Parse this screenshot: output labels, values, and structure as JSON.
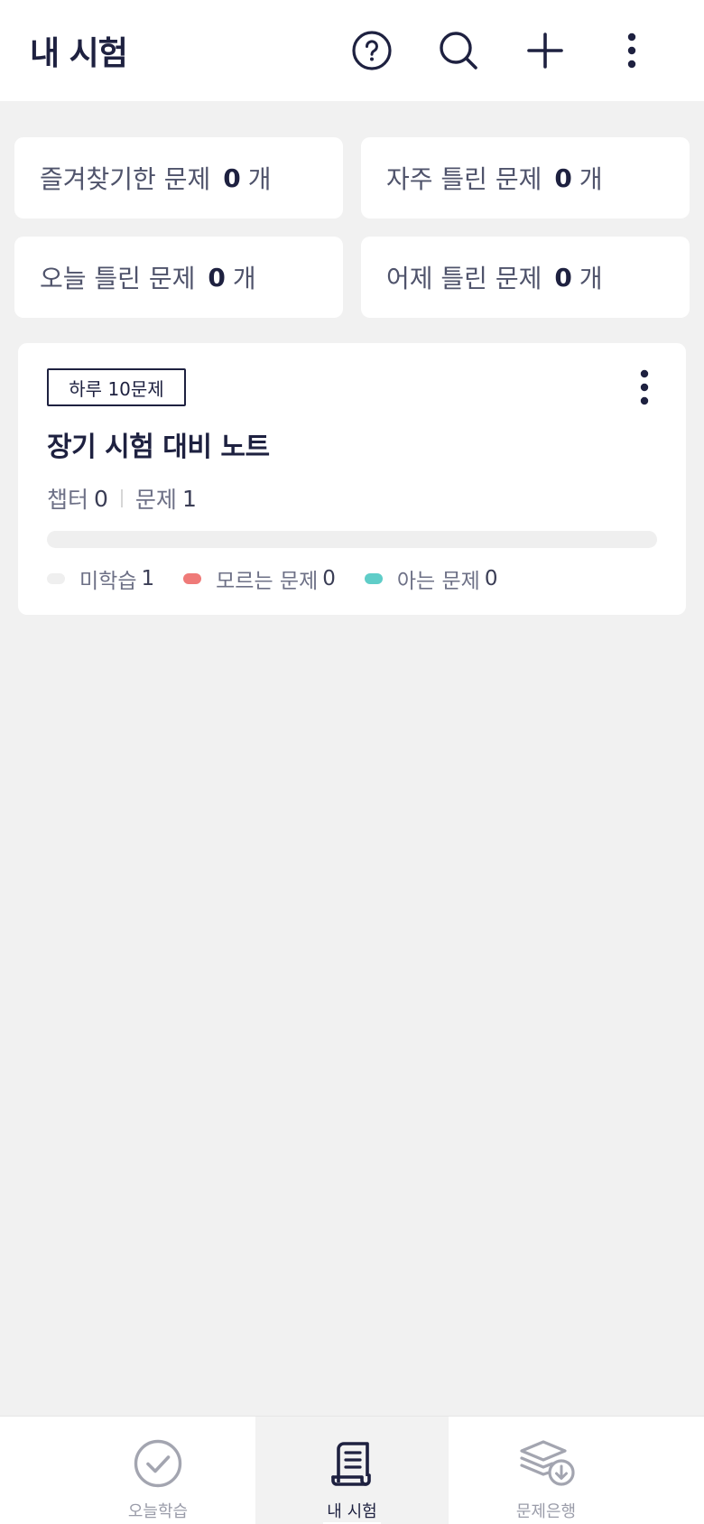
{
  "header": {
    "title": "내 시험",
    "icons": [
      "help-icon",
      "search-icon",
      "plus-icon",
      "more-vertical-icon"
    ]
  },
  "stats": [
    {
      "label": "즐겨찾기한 문제",
      "count": "0",
      "unit": "개"
    },
    {
      "label": "자주 틀린 문제",
      "count": "0",
      "unit": "개"
    },
    {
      "label": "오늘 틀린 문제",
      "count": "0",
      "unit": "개"
    },
    {
      "label": "어제 틀린 문제",
      "count": "0",
      "unit": "개"
    }
  ],
  "exam_card": {
    "badge": "하루 10문제",
    "title": "장기 시험 대비 노트",
    "chapter_label": "챕터",
    "chapter_count": "0",
    "question_label": "문제",
    "question_count": "1",
    "progress": {
      "unknown": 0,
      "known": 0,
      "unstudied": 1
    },
    "legend": [
      {
        "label": "미학습",
        "value": "1",
        "color": "#efefef"
      },
      {
        "label": "모르는 문제",
        "value": "0",
        "color": "#ef7a78"
      },
      {
        "label": "아는 문제",
        "value": "0",
        "color": "#5fcdc8"
      }
    ]
  },
  "bottom_nav": [
    {
      "label": "오늘학습",
      "icon": "check-circle-icon",
      "active": false
    },
    {
      "label": "내 시험",
      "icon": "scroll-icon",
      "active": true
    },
    {
      "label": "문제은행",
      "icon": "layers-download-icon",
      "active": false
    }
  ],
  "colors": {
    "primary": "#1e2140",
    "background": "#f1f1f1",
    "unknown": "#ef7a78",
    "known": "#5fcdc8"
  }
}
